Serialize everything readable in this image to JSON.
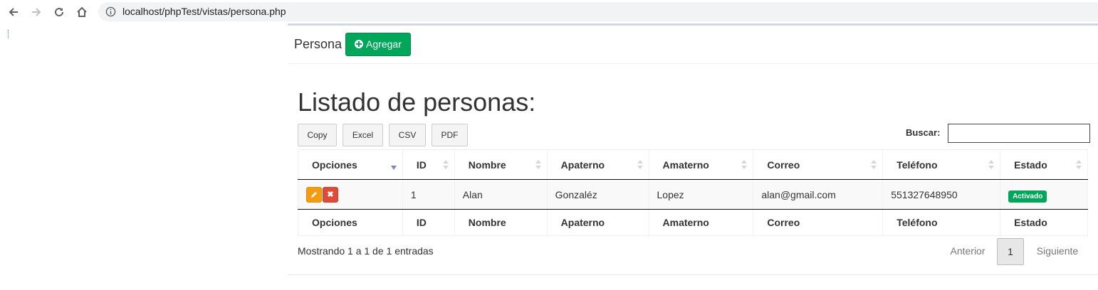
{
  "browser": {
    "url": "localhost/phpTest/vistas/persona.php",
    "icons": [
      "back-icon",
      "forward-icon",
      "reload-icon",
      "home-icon",
      "info-icon"
    ]
  },
  "header": {
    "title": "Persona",
    "add_label": "Agregar",
    "add_icon": "plus-circle-icon"
  },
  "main": {
    "title": "Listado de personas:",
    "export_buttons": [
      "Copy",
      "Excel",
      "CSV",
      "PDF"
    ],
    "search_label": "Buscar:",
    "search_value": ""
  },
  "table": {
    "columns": [
      "Opciones",
      "ID",
      "Nombre",
      "Apaterno",
      "Amaterno",
      "Correo",
      "Teléfono",
      "Estado"
    ],
    "rows": [
      {
        "actions": [
          "edit-icon",
          "delete-icon"
        ],
        "id": "1",
        "nombre": "Alan",
        "apaterno": "Gonzaléz",
        "amaterno": "Lopez",
        "correo": "alan@gmail.com",
        "telefono": "551327648950",
        "estado": "Activado"
      }
    ]
  },
  "footer": {
    "info": "Mostrando 1 a 1 de 1 entradas",
    "prev_label": "Anterior",
    "current_page": "1",
    "next_label": "Siguiente"
  },
  "colors": {
    "primary_green": "#00a65a",
    "edit_orange": "#f39c12",
    "delete_red": "#dd4b39"
  }
}
